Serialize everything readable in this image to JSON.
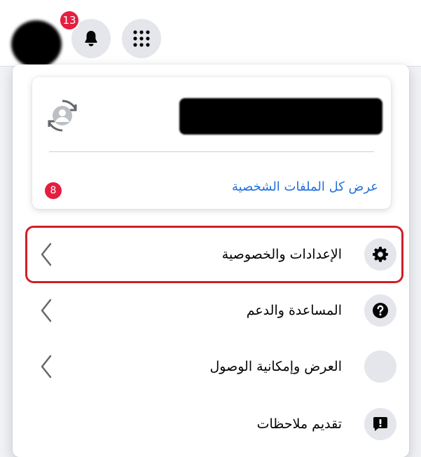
{
  "header": {
    "notifications_count": "13"
  },
  "profile_card": {
    "see_all_label": "عرض كل الملفات الشخصية",
    "profiles_badge": "8"
  },
  "menu": {
    "items": [
      {
        "label": "الإعدادات والخصوصية",
        "icon": "gear-icon",
        "has_chevron": true
      },
      {
        "label": "المساعدة والدعم",
        "icon": "help-icon",
        "has_chevron": true
      },
      {
        "label": "العرض وإمكانية الوصول",
        "icon": "moon-icon",
        "has_chevron": true
      },
      {
        "label": "تقديم ملاحظات",
        "icon": "feedback-icon",
        "has_chevron": false
      }
    ]
  },
  "colors": {
    "accent_link": "#216fdb",
    "badge_red": "#e41e3f",
    "highlight_border": "#d11f28",
    "icon_bg": "#e4e6eb"
  }
}
